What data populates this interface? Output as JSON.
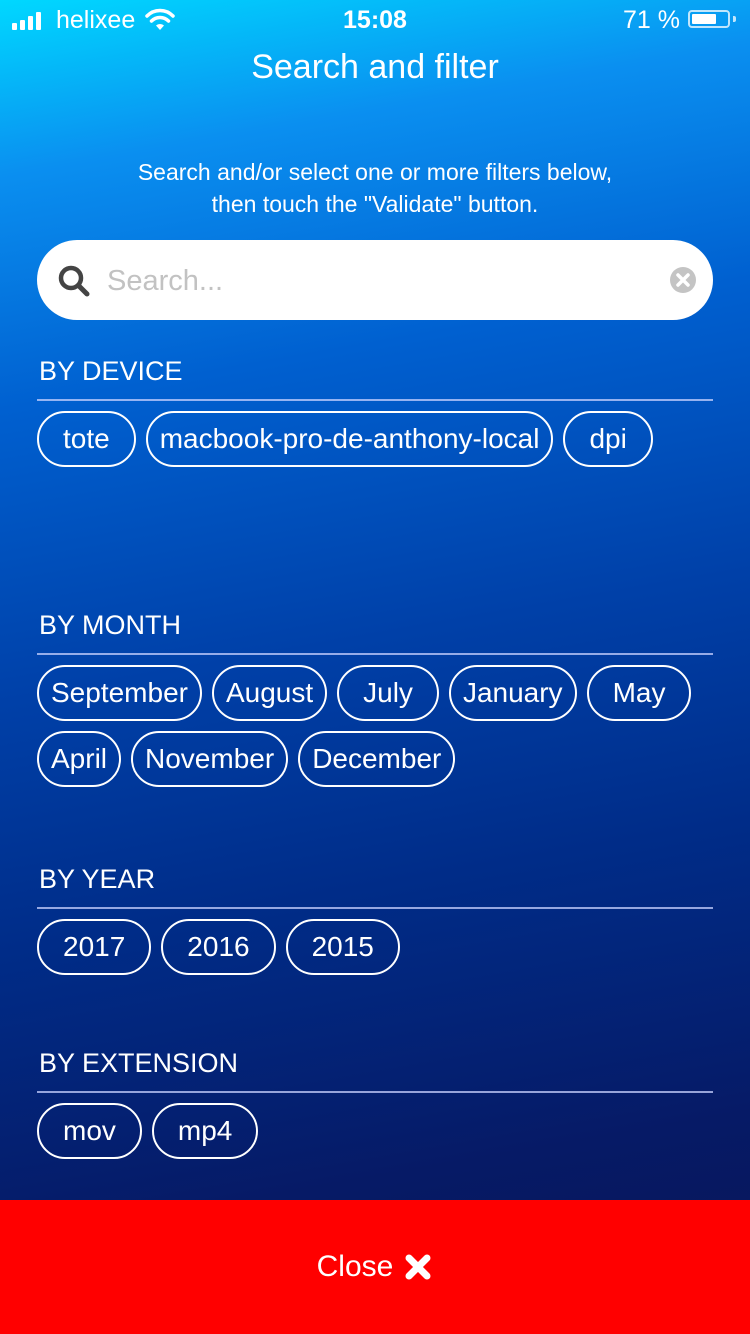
{
  "status_bar": {
    "carrier": "helixee",
    "time": "15:08",
    "battery_percent_label": "71 %",
    "battery_level": 0.71
  },
  "header": {
    "title": "Search and filter"
  },
  "instructions": {
    "line1": "Search and/or select one or more filters below,",
    "line2": "then touch the \"Validate\" button."
  },
  "search": {
    "value": "",
    "placeholder": "Search..."
  },
  "sections": {
    "device": {
      "title": "BY DEVICE",
      "chips": [
        "tote",
        "macbook-pro-de-anthony-local",
        "dpi"
      ]
    },
    "month": {
      "title": "BY MONTH",
      "chips": [
        "September",
        "August",
        "July",
        "January",
        "May",
        "April",
        "November",
        "December"
      ]
    },
    "year": {
      "title": "BY YEAR",
      "chips": [
        "2017",
        "2016",
        "2015"
      ]
    },
    "extension": {
      "title": "BY EXTENSION",
      "chips": [
        "mov",
        "mp4"
      ]
    }
  },
  "footer": {
    "close_label": "Close"
  },
  "colors": {
    "close_bar": "#ff0000",
    "gradient_top": "#00d8ff",
    "gradient_bottom": "#0a1455"
  }
}
